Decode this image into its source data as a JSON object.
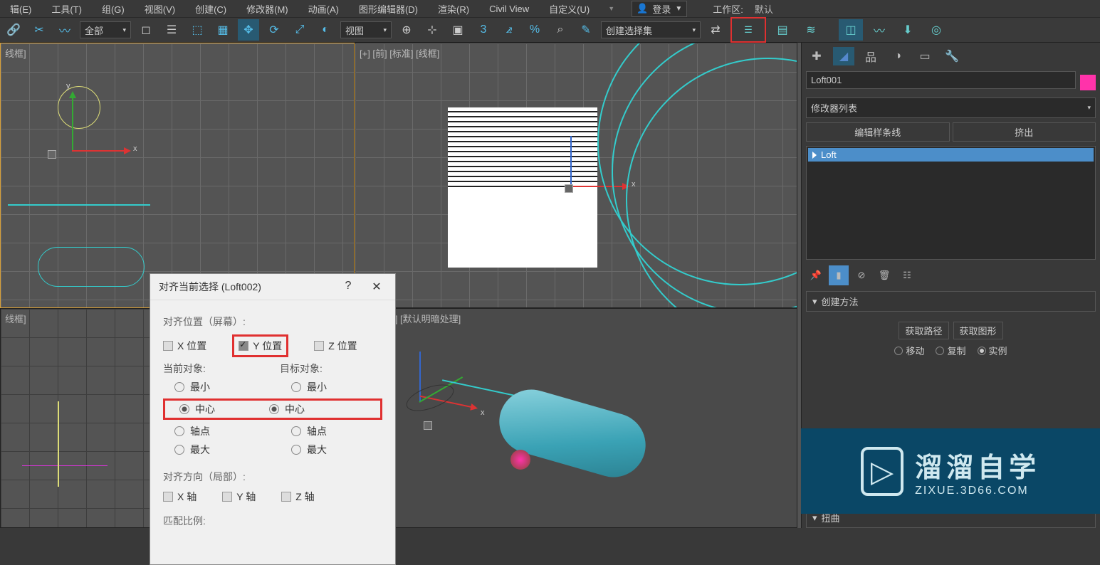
{
  "menu": {
    "items": [
      {
        "label": "辑(E)"
      },
      {
        "label": "工具(T)"
      },
      {
        "label": "组(G)"
      },
      {
        "label": "视图(V)"
      },
      {
        "label": "创建(C)"
      },
      {
        "label": "修改器(M)"
      },
      {
        "label": "动画(A)"
      },
      {
        "label": "图形编辑器(D)"
      },
      {
        "label": "渲染(R)"
      },
      {
        "label": "Civil View"
      },
      {
        "label": "自定义(U)"
      }
    ],
    "login_label": "登录",
    "workspace_label": "工作区:",
    "workspace_value": "默认"
  },
  "toolbar": {
    "filter_all": "全部",
    "coord_view": "视图",
    "selset_label": "创建选择集"
  },
  "viewports": {
    "tl_label": "线框]",
    "tr_label": "[+] [前] [标准] [线框]",
    "bl_label": "线框]",
    "br_label": "视] [标准] [默认明暗处理]",
    "axis_x": "x",
    "axis_y": "y"
  },
  "dialog": {
    "title": "对齐当前选择 (Loft002)",
    "help": "?",
    "close": "✕",
    "align_pos_heading": "对齐位置（屏幕）:",
    "x_pos": "X 位置",
    "y_pos": "Y 位置",
    "z_pos": "Z 位置",
    "current_obj": "当前对象:",
    "target_obj": "目标对象:",
    "min": "最小",
    "center": "中心",
    "pivot": "轴点",
    "max": "最大",
    "align_orient_heading": "对齐方向（局部）:",
    "x_axis": "X 轴",
    "y_axis": "Y 轴",
    "z_axis": "Z 轴",
    "match_scale_heading": "匹配比例:"
  },
  "right_panel": {
    "object_name": "Loft001",
    "modifier_list_label": "修改器列表",
    "btn_edit_spline": "编辑样条线",
    "btn_extrude": "挤出",
    "stack_item": "Loft",
    "rollout_create_method": "创建方法",
    "btn_get_path": "获取路径",
    "btn_get_shape": "获取图形",
    "radio_move": "移动",
    "radio_copy": "复制",
    "radio_instance": "实例",
    "rollout_twist": "扭曲"
  },
  "watermark": {
    "line1": "溜溜自学",
    "line2": "ZIXUE.3D66.COM",
    "logo_glyph": "▷"
  }
}
